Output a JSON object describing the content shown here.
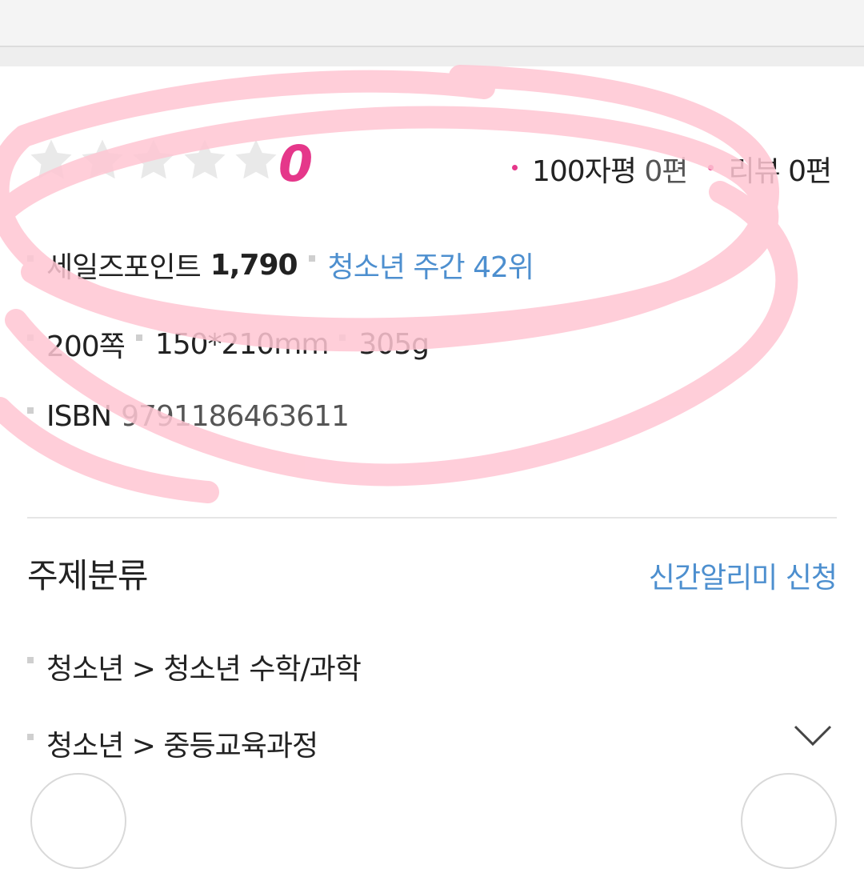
{
  "rating": {
    "stars_filled": 0,
    "stars_total": 5,
    "score": "0",
    "short_review_label": "100자평",
    "short_review_count": "0편",
    "review_label": "리뷰",
    "review_count": "0편"
  },
  "info": {
    "salespoint_label": "세일즈포인트",
    "salespoint_value": "1,790",
    "rank_text": "청소년 주간 42위",
    "pages": "200쪽",
    "size": "150*210mm",
    "weight": "305g",
    "isbn_label": "ISBN",
    "isbn_value": "9791186463611"
  },
  "category": {
    "title": "주제분류",
    "notify_link": "신간알리미 신청",
    "items": [
      {
        "path": "청소년 > 청소년 수학/과학"
      },
      {
        "path": "청소년 > 중등교육과정"
      }
    ]
  },
  "colors": {
    "accent_pink": "#e5378a",
    "link_blue": "#4d8fcf",
    "highlight_stroke": "#ffc6d3",
    "star_empty": "#e9e9e9"
  },
  "icons": {
    "star": "star-empty-icon",
    "expand": "chevron-down-icon"
  }
}
